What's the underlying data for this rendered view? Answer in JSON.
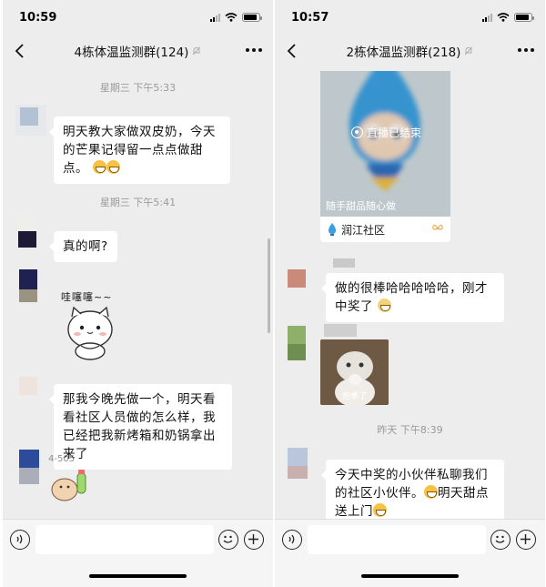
{
  "left": {
    "status": {
      "time": "10:59"
    },
    "title": "4栋体温监测群(124)",
    "messages": {
      "ts1": "星期三 下午5:33",
      "m1": "明天教大家做双皮奶，今天的芒果记得留一点点做甜点。",
      "ts2": "星期三 下午5:41",
      "m2": "真的啊?",
      "sticker_text": "哇噻噻~~",
      "m3": "那我今晚先做一个，明天看看社区人员做的怎么样，我已经把我新烤箱和奶锅拿出来了",
      "sender": "4-505"
    }
  },
  "right": {
    "status": {
      "time": "10:57"
    },
    "title": "2栋体温监测群(218)",
    "live_card": {
      "status": "直播已结束",
      "caption": "随手甜品随心做",
      "channel": "润江社区"
    },
    "messages": {
      "m1": "做的很棒哈哈哈哈哈，刚才中奖了",
      "photo_caption": "抱拳了",
      "ts1": "昨天 下午8:39",
      "m2": "今天中奖的小伙伴私聊我们的社区小伙伴。",
      "m2b": "明天甜点送上门"
    }
  },
  "icons": {
    "back": "chevron-left-icon",
    "mute": "bell-muted-icon",
    "more": "more-dots-icon",
    "voice": "voice-icon",
    "emoji": "emoji-icon",
    "plus": "plus-icon"
  },
  "colors": {
    "chat_bg": "#ededed",
    "bubble": "#ffffff",
    "timestamp": "#9a9a9a"
  }
}
